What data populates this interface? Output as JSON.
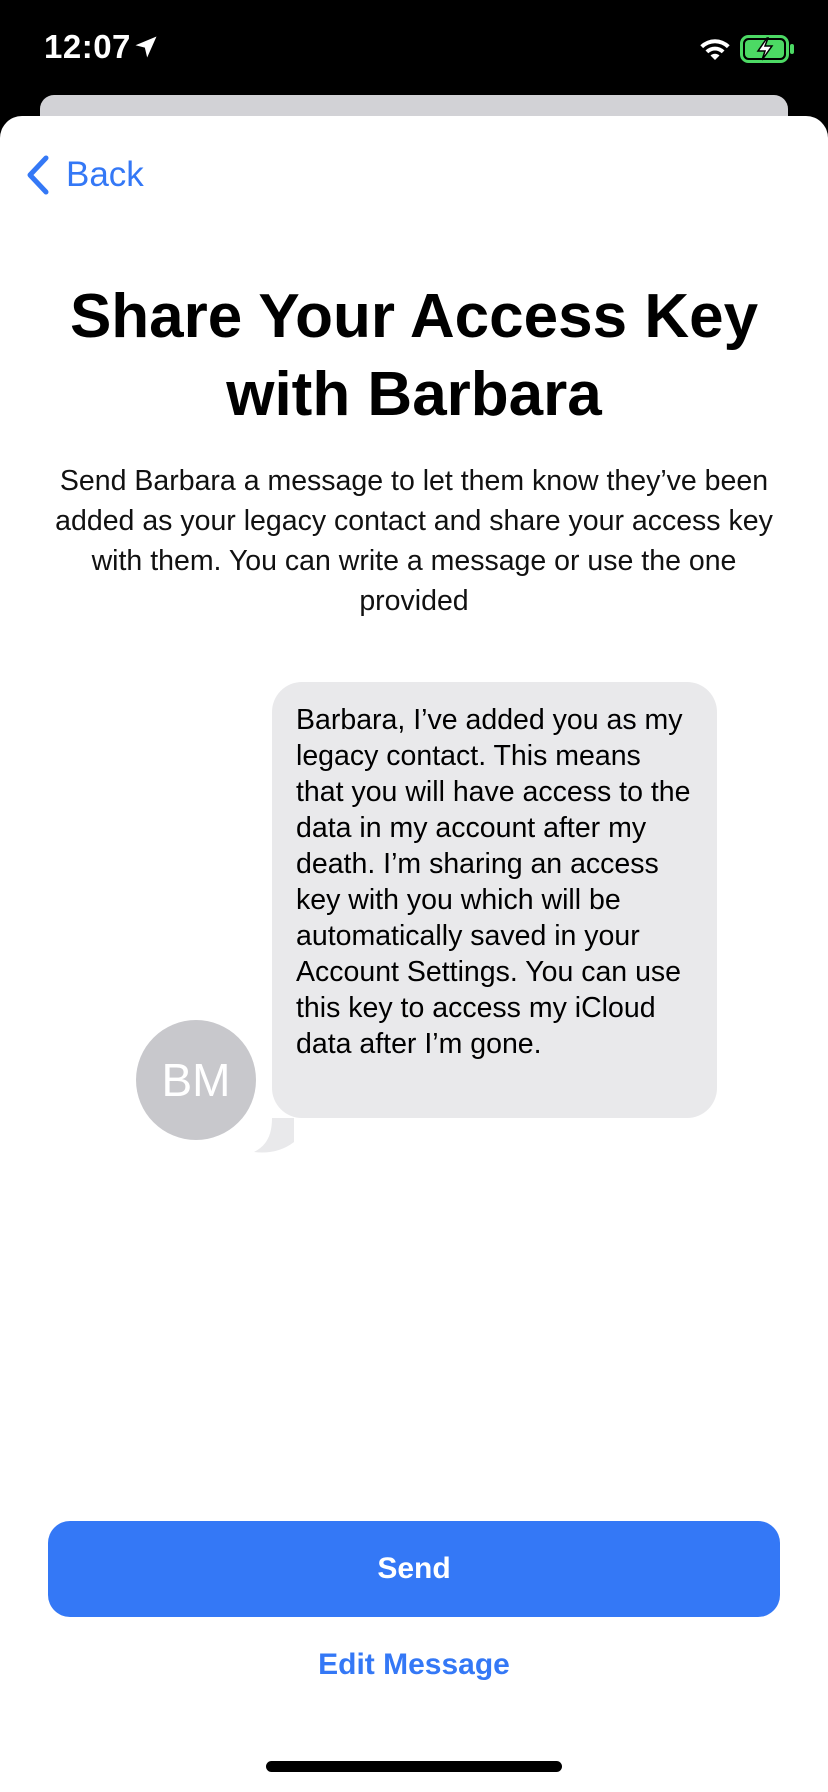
{
  "status_bar": {
    "time": "12:07",
    "icons": [
      "location-arrow-icon",
      "wifi-icon",
      "battery-charging-icon"
    ],
    "battery_color": "#4cd964"
  },
  "navigation": {
    "back_label": "Back"
  },
  "header": {
    "title_line1": "Share Your Access Key",
    "title_line2": "with Barbara",
    "subtitle": "Send Barbara a message to let them know they’ve been added as your legacy contact and share your access key with them. You can write a message or use the one provided"
  },
  "message_preview": {
    "avatar_initials": "BM",
    "text": "Barbara, I’ve added you as my legacy contact. This means that you will have access to the data in my account after my death. I’m sharing an access key with you which will be automatically saved in your Account Settings. You can use this key to access my iCloud data after I’m gone."
  },
  "actions": {
    "send_label": "Send",
    "edit_label": "Edit Message"
  },
  "colors": {
    "accent": "#3478f6",
    "bubble": "#e9e9eb",
    "avatar": "#c8c8cc"
  }
}
